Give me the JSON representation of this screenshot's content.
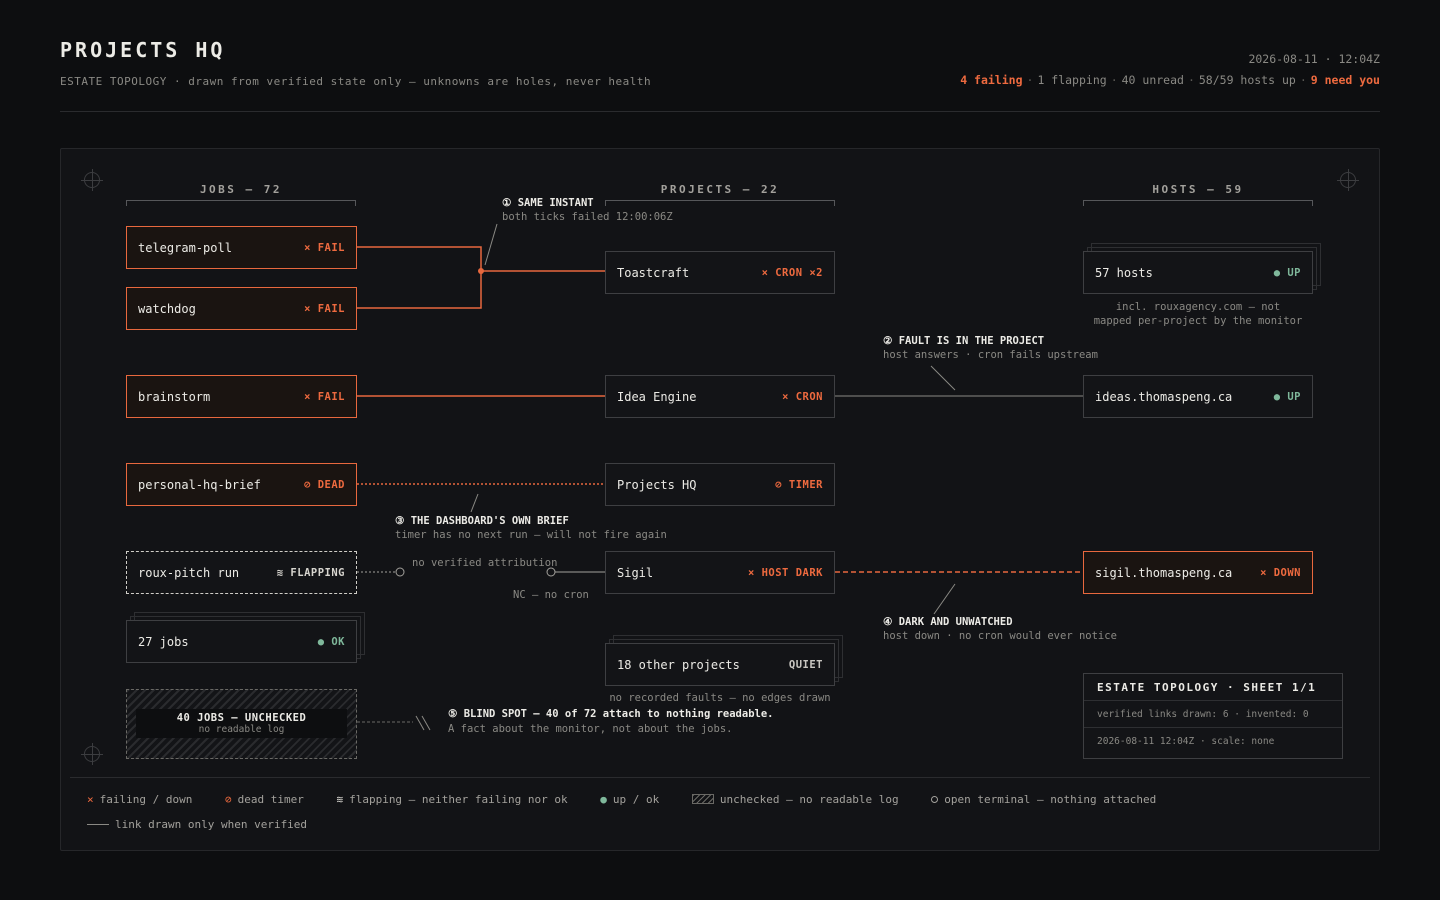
{
  "header": {
    "title": "PROJECTS HQ",
    "subtitle": "ESTATE TOPOLOGY · drawn from verified state only — unknowns are holes, never health",
    "timestamp": "2026-08-11 · 12:04Z",
    "status": {
      "failing": "4 failing",
      "flapping": "1 flapping",
      "unread": "40 unread",
      "hosts_up": "58/59 hosts up",
      "need_you": "9 need you"
    }
  },
  "columns": {
    "jobs": "JOBS — 72",
    "projects": "PROJECTS — 22",
    "hosts": "HOSTS — 59"
  },
  "jobs": [
    {
      "name": "telegram-poll",
      "status": "× FAIL"
    },
    {
      "name": "watchdog",
      "status": "× FAIL"
    },
    {
      "name": "brainstorm",
      "status": "× FAIL"
    },
    {
      "name": "personal-hq-brief",
      "status": "⊘ DEAD"
    },
    {
      "name": "roux-pitch run",
      "status": "≋ FLAPPING"
    },
    {
      "name": "27 jobs",
      "status": "● OK"
    }
  ],
  "unchecked": {
    "title": "40 JOBS — UNCHECKED",
    "sub": "no readable log"
  },
  "projects": [
    {
      "name": "Toastcraft",
      "status": "× CRON ×2"
    },
    {
      "name": "Idea Engine",
      "status": "× CRON"
    },
    {
      "name": "Projects HQ",
      "status": "⊘ TIMER"
    },
    {
      "name": "Sigil",
      "status": "× HOST DARK"
    },
    {
      "name": "18 other projects",
      "status": "QUIET"
    }
  ],
  "projects_note": "no recorded faults — no edges drawn",
  "hosts": [
    {
      "name": "57 hosts",
      "status": "● UP"
    },
    {
      "name": "ideas.thomaspeng.ca",
      "status": "● UP"
    },
    {
      "name": "sigil.thomaspeng.ca",
      "status": "× DOWN"
    }
  ],
  "hosts_note": [
    "incl. rouxagency.com — not",
    "mapped per-project by the monitor"
  ],
  "edge_labels": {
    "no_attribution": "no verified attribution",
    "no_cron": "NC — no cron"
  },
  "annotations": [
    {
      "title": "① SAME INSTANT",
      "body": "both ticks failed 12:00:06Z"
    },
    {
      "title": "② FAULT IS IN THE PROJECT",
      "body": "host answers · cron fails upstream"
    },
    {
      "title": "③ THE DASHBOARD'S OWN BRIEF",
      "body": "timer has no next run — will not fire again"
    },
    {
      "title": "④ DARK AND UNWATCHED",
      "body": "host down · no cron would ever notice"
    },
    {
      "title": "⑤ BLIND SPOT — 40 of 72 attach to nothing readable.",
      "body": "A fact about the monitor, not about the jobs."
    }
  ],
  "sheet": {
    "title": "ESTATE TOPOLOGY · SHEET 1/1",
    "links": "verified links drawn: 6 · invented: 0",
    "meta": "2026-08-11 12:04Z · scale: none"
  },
  "legend": {
    "failing": "failing / down",
    "dead": "dead timer",
    "flapping": "flapping — neither failing nor ok",
    "up": "up / ok",
    "unchecked": "unchecked — no readable log",
    "open": "open terminal — nothing attached",
    "link": "link drawn only when verified"
  },
  "colors": {
    "fail": "#ee6a3f",
    "ok": "#7fb89b",
    "background": "#0d0e10",
    "panel": "#121316"
  }
}
